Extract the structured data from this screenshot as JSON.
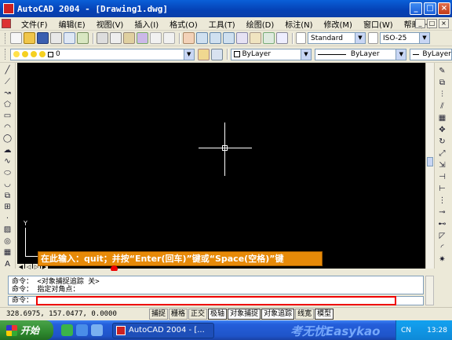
{
  "window": {
    "title": "AutoCAD 2004 - [Drawing1.dwg]",
    "minimize": "_",
    "maximize": "□",
    "close": "×"
  },
  "menu": {
    "items": [
      "文件(F)",
      "编辑(E)",
      "视图(V)",
      "插入(I)",
      "格式(O)",
      "工具(T)",
      "绘图(D)",
      "标注(N)",
      "修改(M)",
      "窗口(W)",
      "帮助(H)"
    ]
  },
  "toolbar": {
    "text_style": "Standard",
    "dim_style": "ISO-25",
    "layer_value": "0",
    "color_value": "ByLayer",
    "linetype_value": "ByLayer",
    "lineweight_value": "ByLayer"
  },
  "ucs": {
    "y_label": "Y",
    "x_label": "X"
  },
  "annotation": {
    "text": "在此输入：quit；并按“Enter(回车)”键或“Space(空格)”键"
  },
  "command": {
    "history": [
      "命令：  <对象捕捉追踪 关>",
      "命令：  指定对角点："
    ],
    "prompt": "命令："
  },
  "status": {
    "coords": "328.6975, 157.0477, 0.0000",
    "buttons": [
      {
        "label": "捕捉",
        "on": false
      },
      {
        "label": "栅格",
        "on": false
      },
      {
        "label": "正交",
        "on": false
      },
      {
        "label": "极轴",
        "on": true
      },
      {
        "label": "对象捕捉",
        "on": true
      },
      {
        "label": "对象追踪",
        "on": true
      },
      {
        "label": "线宽",
        "on": false
      },
      {
        "label": "模型",
        "on": true
      }
    ]
  },
  "taskbar": {
    "start_label": "开始",
    "task_label": "AutoCAD 2004 - [...",
    "watermark": "考无忧Easykao",
    "lang": "CN",
    "time": "13:28"
  },
  "colors": {
    "canvas": "#000000",
    "banner": "#e78a08",
    "highlight": "#ee0000"
  }
}
